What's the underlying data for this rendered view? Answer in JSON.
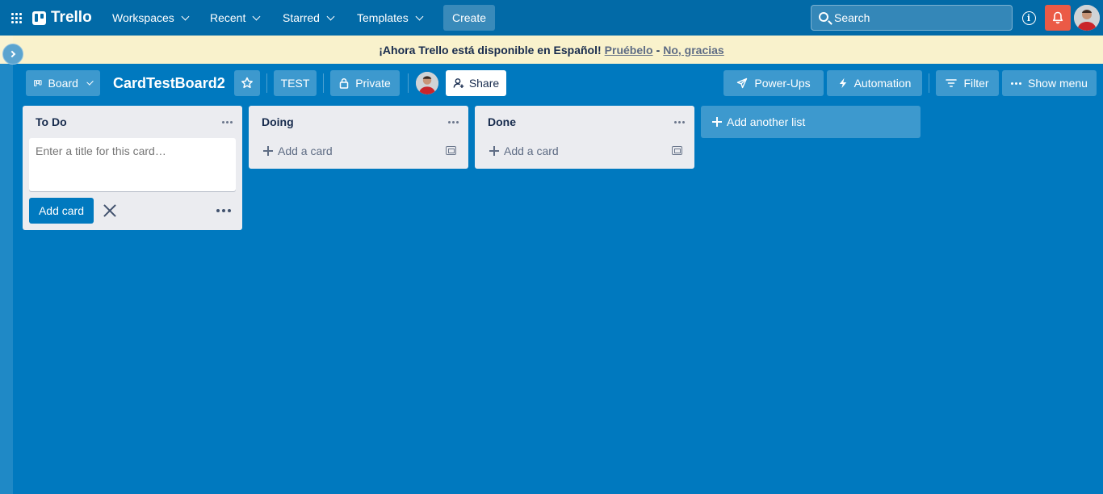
{
  "topnav": {
    "logo_text": "Trello",
    "menus": [
      {
        "label": "Workspaces"
      },
      {
        "label": "Recent"
      },
      {
        "label": "Starred"
      },
      {
        "label": "Templates"
      }
    ],
    "create_label": "Create",
    "search_placeholder": "Search",
    "info_glyph": "i"
  },
  "banner": {
    "text": "¡Ahora Trello está disponible en Español!",
    "try_link": "Pruébelo",
    "separator": "-",
    "decline_link": "No, gracias"
  },
  "board_header": {
    "view_label": "Board",
    "title": "CardTestBoard2",
    "workspace_label": "TEST",
    "visibility_label": "Private",
    "share_label": "Share",
    "powerups_label": "Power-Ups",
    "automation_label": "Automation",
    "filter_label": "Filter",
    "show_menu_label": "Show menu"
  },
  "lists": [
    {
      "title": "To Do",
      "composer_placeholder": "Enter a title for this card…",
      "add_card_button": "Add card"
    },
    {
      "title": "Doing",
      "add_card_label": "Add a card"
    },
    {
      "title": "Done",
      "add_card_label": "Add a card"
    }
  ],
  "add_list_label": "Add another list",
  "colors": {
    "board_bg": "#0079bf",
    "nav_bg": "#026aa7",
    "banner_bg": "#f9f2cc",
    "list_bg": "#ebecf0",
    "notification": "#eb5a46"
  },
  "icons": [
    "apps-grid-icon",
    "trello-logo-icon",
    "chevron-down-icon",
    "search-icon",
    "info-icon",
    "bell-icon",
    "avatar",
    "board-view-icon",
    "star-icon",
    "lock-icon",
    "add-person-icon",
    "rocket-icon",
    "lightning-icon",
    "filter-icon",
    "ellipsis-icon",
    "plus-icon",
    "template-icon",
    "close-icon"
  ]
}
